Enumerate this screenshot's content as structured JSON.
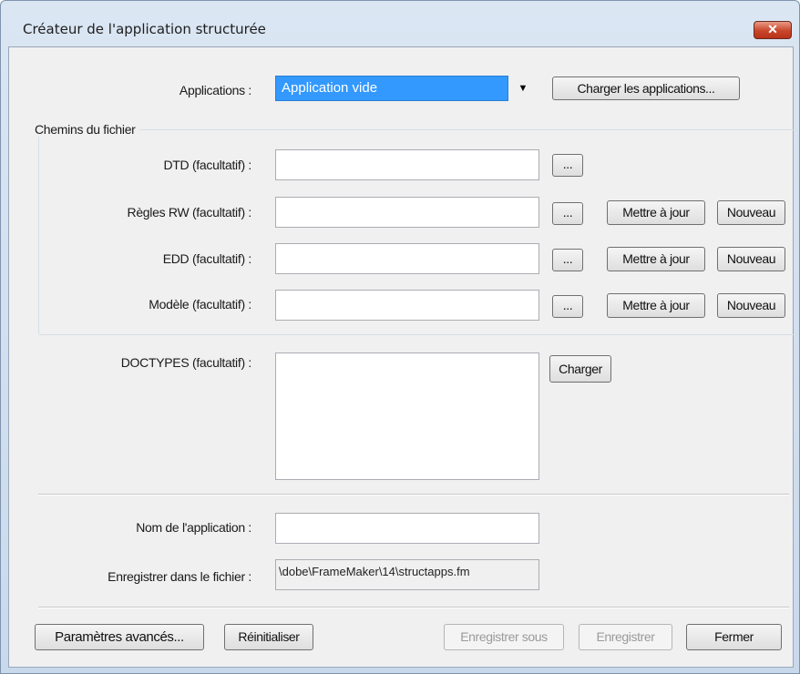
{
  "window": {
    "title": "Créateur de l'application structurée",
    "close_label": "✕"
  },
  "applications": {
    "label": "Applications :",
    "selected": "Application vide",
    "load_button": "Charger les applications..."
  },
  "paths": {
    "group_label": "Chemins du fichier",
    "dtd_label": "DTD (facultatif) :",
    "rw_label": "Règles RW (facultatif) :",
    "edd_label": "EDD (facultatif) :",
    "template_label": "Modèle (facultatif) :",
    "browse_label": "...",
    "update_label": "Mettre à jour",
    "new_label": "Nouveau"
  },
  "doctypes": {
    "label": "DOCTYPES (facultatif) :",
    "load_button": "Charger"
  },
  "app_name": {
    "label": "Nom de l'application :",
    "value": ""
  },
  "save_file": {
    "label": "Enregistrer dans le fichier :",
    "value": "\\dobe\\FrameMaker\\14\\structapps.fm"
  },
  "footer": {
    "advanced": "Paramètres avancés...",
    "reset": "Réinitialiser",
    "save_as": "Enregistrer sous",
    "save": "Enregistrer",
    "close": "Fermer"
  }
}
